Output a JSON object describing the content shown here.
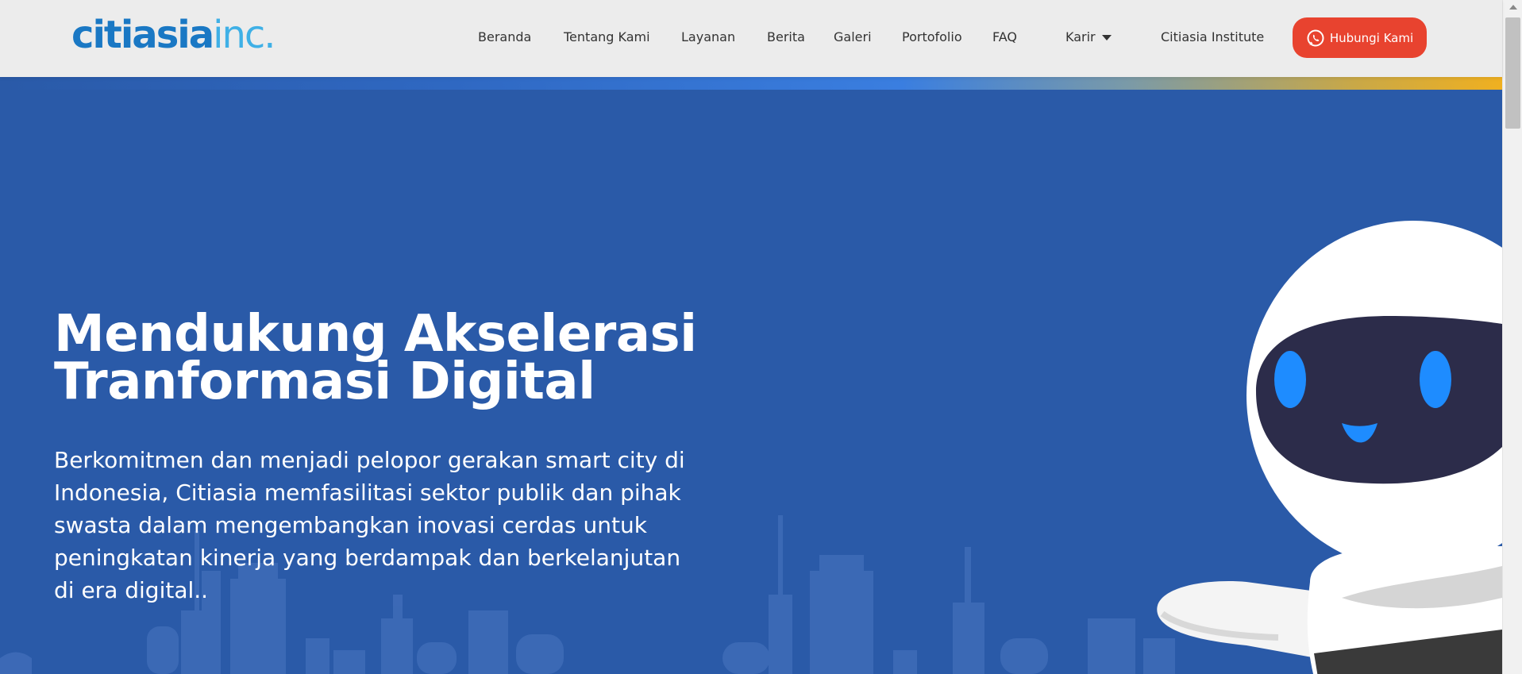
{
  "logo": {
    "part1": "citiasia",
    "part2": "inc."
  },
  "nav": {
    "items": [
      {
        "label": "Beranda"
      },
      {
        "label": "Tentang Kami"
      },
      {
        "label": "Layanan"
      },
      {
        "label": "Berita"
      },
      {
        "label": "Galeri"
      },
      {
        "label": "Portofolio"
      },
      {
        "label": "FAQ"
      },
      {
        "label": "Karir"
      },
      {
        "label": "Citiasia Institute"
      }
    ],
    "cta_label": "Hubungi Kami",
    "cta_icon": "whatsapp-icon"
  },
  "hero": {
    "headline": "Mendukung Akselerasi Tranformasi Digital",
    "subtext": "Berkomitmen dan menjadi pelopor gerakan smart city di Indonesia, Citiasia memfasilitasi sektor publik dan pihak swasta dalam mengembangkan inovasi cerdas untuk peningkatan kinerja yang berdampak dan berkelanjutan di era digital.."
  },
  "colors": {
    "hero_bg": "#2a5aa8",
    "cta_bg": "#e8432f",
    "logo_primary": "#1a78c4",
    "logo_secondary": "#3fb0e6"
  }
}
